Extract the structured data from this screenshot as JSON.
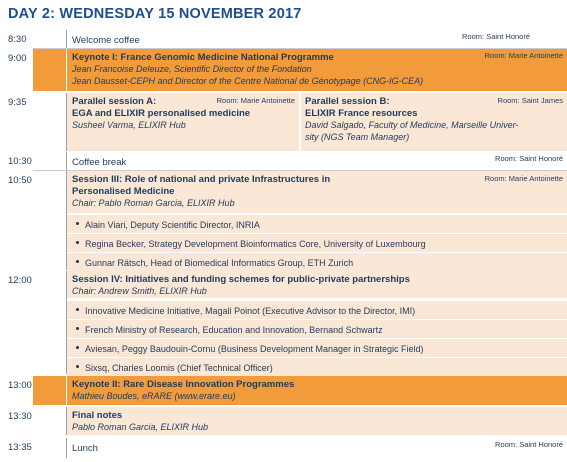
{
  "day_title": "DAY 2: WEDNESDAY 15 NOVEMBER 2017",
  "rows": [
    {
      "time": "8:30",
      "title": "Welcome coffee",
      "room": "Room: Saint Honoré"
    },
    {
      "time": "9:00",
      "title": "Keynote I: France Genomic Medicine National Programme",
      "lines": [
        "Jean Francoise Deleuze, Scientific Director of the Fondation",
        "Jean Dausset-CEPH and Director of the Centre National de Génotypage (CNG-IG-CEA)"
      ],
      "room": "Room: Marie Antoinette"
    },
    {
      "time": "9:35",
      "a_title": "Parallel session A:",
      "a_title2": "EGA and ELIXIR personalised medicine",
      "a_speaker": "Susheel Varma, ELIXIR Hub",
      "a_room": "Room: Marie Antoinette",
      "b_title": "Parallel session B:",
      "b_title2": "ELIXIR France resources",
      "b_speaker": "David Salgado, Faculty of Medicine, Marseille Univer-",
      "b_speaker2": "sity (NGS Team Manager)",
      "b_room": "Room: Saint James"
    },
    {
      "time": "10:30",
      "title": "Coffee break",
      "room": "Room: Saint Honoré"
    },
    {
      "time": "10:50",
      "title": "Session III: Role of national and private Infrastructures in",
      "title2": "Personalised Medicine",
      "chair": "Chair: Pablo Roman Garcia, ELIXIR Hub",
      "room": "Room: Marie Antoinette",
      "bullets": [
        "Alain Viari, Deputy Scientific Director, INRIA",
        "Regina Becker, Strategy Development Bioinformatics Core, University of Luxembourg",
        "Gunnar Rätsch, Head of Biomedical Informatics Group, ETH Zurich"
      ]
    },
    {
      "time": "12:00",
      "title": "Session IV: Initiatives and funding schemes for public-private partnerships",
      "chair": "Chair: Andrew Smith, ELIXIR Hub",
      "bullets": [
        "Innovative Medicine Initiative, Magali Poinot (Executive Advisor to the Director, IMI)",
        "French Ministry of Research, Education and Innovation, Bernand Schwartz",
        "Aviesan, Peggy Baudouin-Cornu (Business Development Manager in Strategic Field)",
        "Sixsq, Charles Loomis (Chief Technical Officer)"
      ]
    },
    {
      "time": "13:00",
      "title": "Keynote II: Rare Disease Innovation Programmes",
      "speaker": "Mathieu Boudes, eRARE (www.erare.eu)"
    },
    {
      "time": "13:30",
      "title": "Final notes",
      "speaker": "Pablo Roman Garcia, ELIXIR Hub"
    },
    {
      "time": "13:35",
      "title": "Lunch",
      "room": "Room: Saint Honoré"
    }
  ]
}
